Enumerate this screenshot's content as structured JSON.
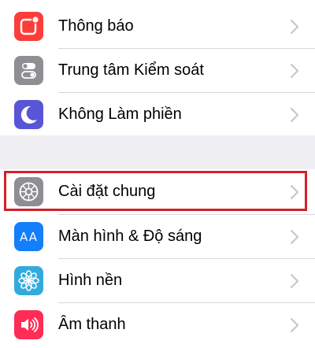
{
  "colors": {
    "background": "#efeff4",
    "highlight": "#d4202a",
    "chevron": "#c7c7cc"
  },
  "group1": {
    "items": [
      {
        "label": "Thông báo",
        "icon": "notifications-icon",
        "color": "#fc3d39"
      },
      {
        "label": "Trung tâm Kiểm soát",
        "icon": "control-center-icon",
        "color": "#8e8e93"
      },
      {
        "label": "Không Làm phiền",
        "icon": "moon-icon",
        "color": "#5856d6"
      }
    ]
  },
  "group2": {
    "items": [
      {
        "label": "Cài đặt chung",
        "icon": "gear-icon",
        "color": "#8e8e93",
        "highlighted": true
      },
      {
        "label": "Màn hình & Độ sáng",
        "icon": "display-brightness-icon",
        "color": "#147efb",
        "icon_text": "AA"
      },
      {
        "label": "Hình nền",
        "icon": "wallpaper-flower-icon",
        "color": "#34aadc"
      },
      {
        "label": "Âm thanh",
        "icon": "speaker-icon",
        "color": "#ff2d55"
      }
    ]
  }
}
